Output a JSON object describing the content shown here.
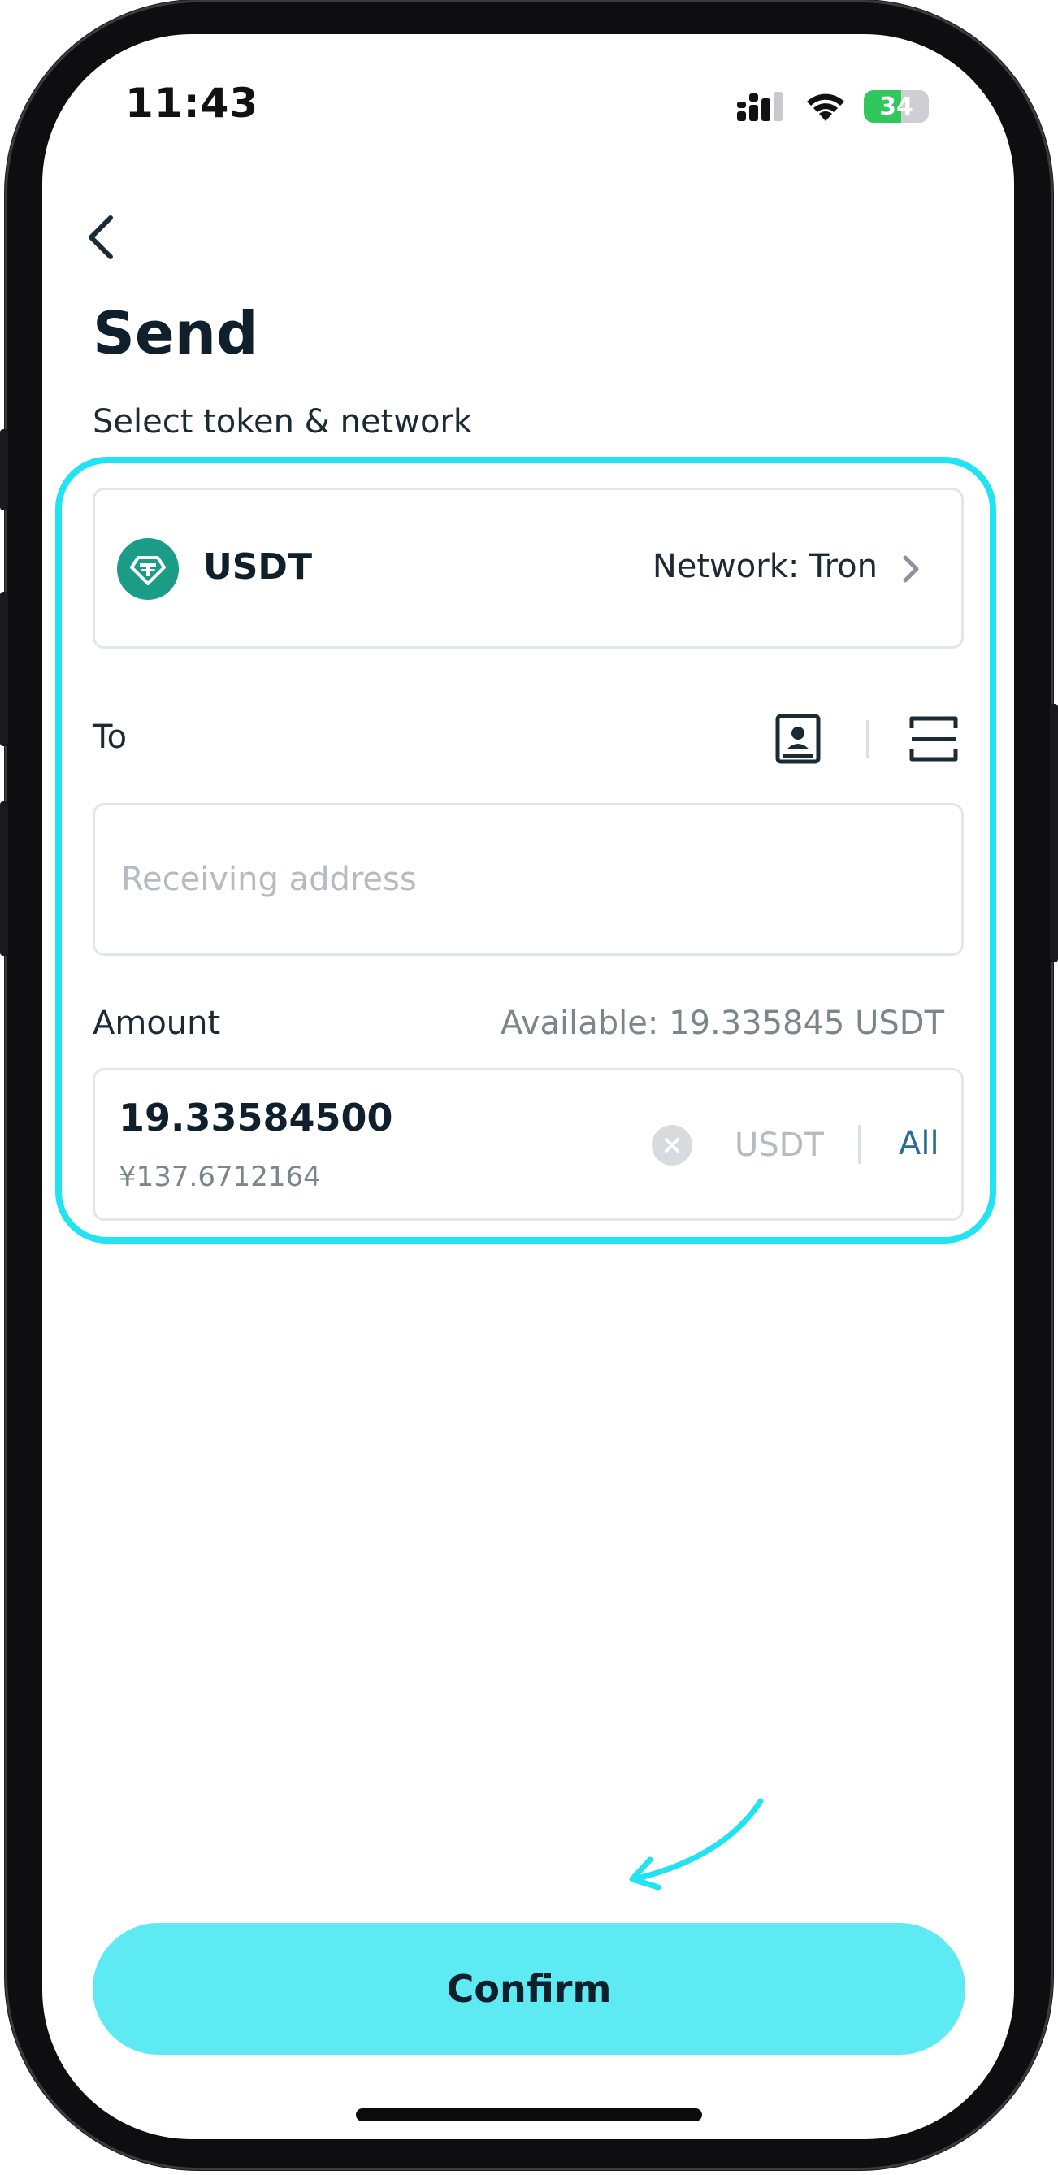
{
  "status_bar": {
    "time": "11:43",
    "battery_level": "34"
  },
  "header": {
    "title": "Send",
    "subtitle": "Select token & network"
  },
  "token": {
    "symbol": "USDT",
    "network": "Network: Tron",
    "logo_color": "#1a9c87"
  },
  "recipient": {
    "label": "To",
    "placeholder": "Receiving address",
    "value": ""
  },
  "amount": {
    "label": "Amount",
    "available": "Available: 19.335845 USDT",
    "value": "19.33584500",
    "fiat_value": "¥137.6712164",
    "unit": "USDT",
    "all_label": "All"
  },
  "confirm": {
    "label": "Confirm"
  },
  "colors": {
    "highlight": "#22e3f2",
    "confirm_bg": "#5eeaf3",
    "link": "#2a6f8f"
  }
}
